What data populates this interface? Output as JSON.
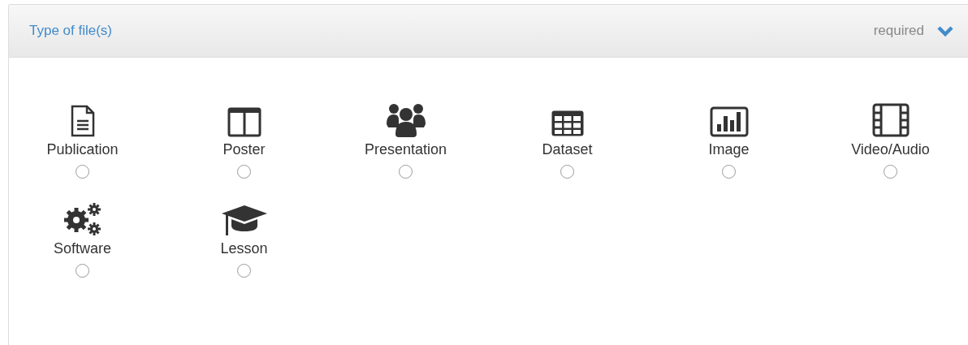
{
  "panel": {
    "title": "Type of file(s)",
    "badge": "required",
    "expanded": true
  },
  "options": [
    {
      "label": "Publication",
      "selected": false
    },
    {
      "label": "Poster",
      "selected": false
    },
    {
      "label": "Presentation",
      "selected": false
    },
    {
      "label": "Dataset",
      "selected": false
    },
    {
      "label": "Image",
      "selected": false
    },
    {
      "label": "Video/Audio",
      "selected": false
    },
    {
      "label": "Software",
      "selected": false
    },
    {
      "label": "Lesson",
      "selected": false
    }
  ]
}
